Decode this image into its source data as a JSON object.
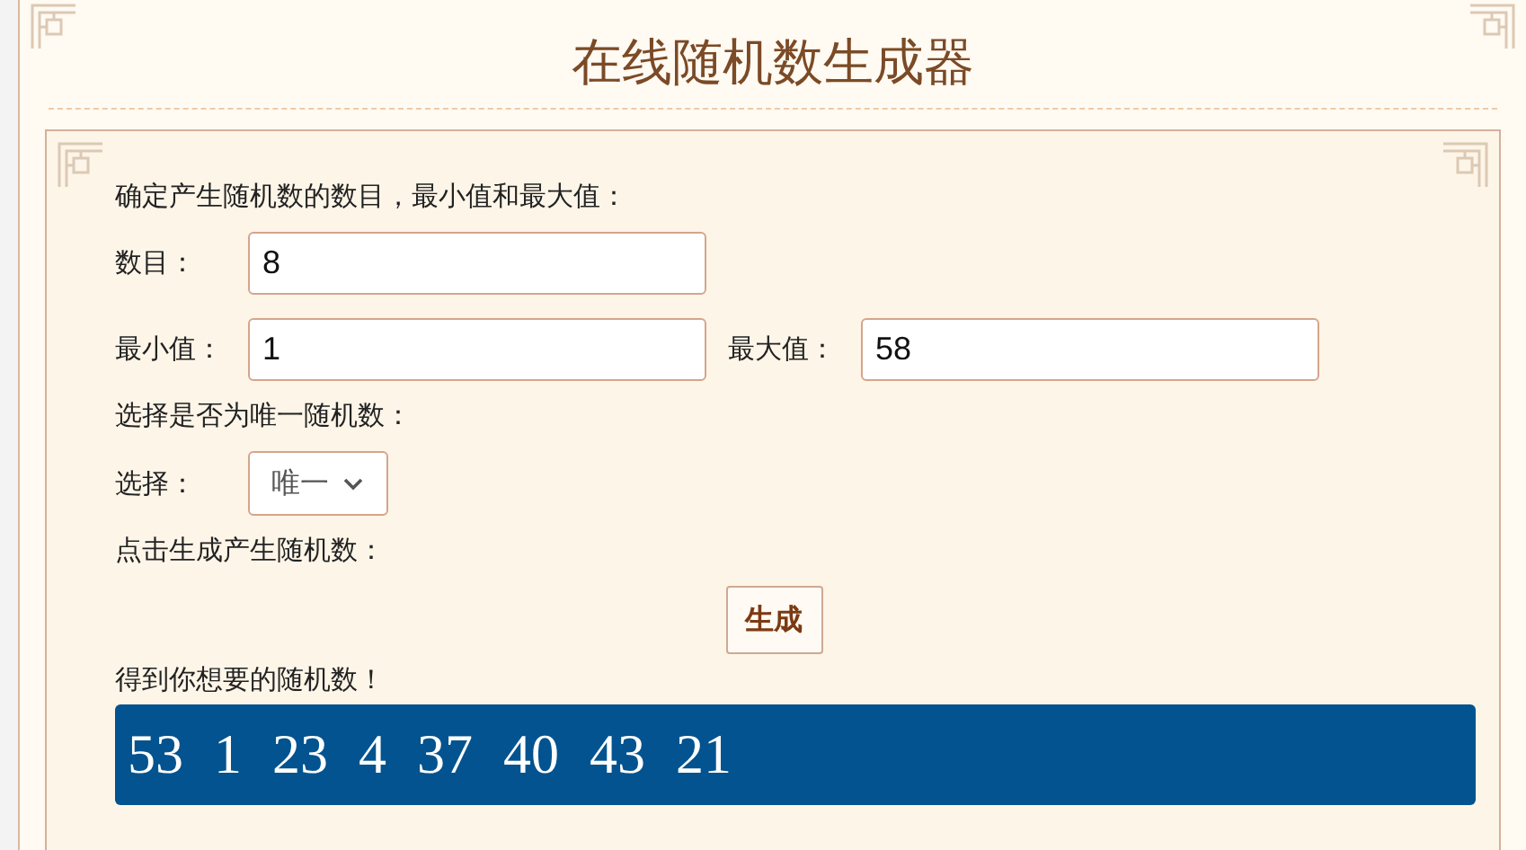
{
  "title": "在线随机数生成器",
  "intro": "确定产生随机数的数目，最小值和最大值：",
  "count": {
    "label": "数目：",
    "value": "8"
  },
  "min": {
    "label": "最小值：",
    "value": "1"
  },
  "max": {
    "label": "最大值：",
    "value": "58"
  },
  "unique_prompt": "选择是否为唯一随机数：",
  "choice": {
    "label": "选择：",
    "value": "唯一"
  },
  "generate_prompt": "点击生成产生随机数：",
  "generate_button": "生成",
  "result_prompt": "得到你想要的随机数！",
  "results": [
    "53",
    "1",
    "23",
    "4",
    "37",
    "40",
    "43",
    "21"
  ]
}
